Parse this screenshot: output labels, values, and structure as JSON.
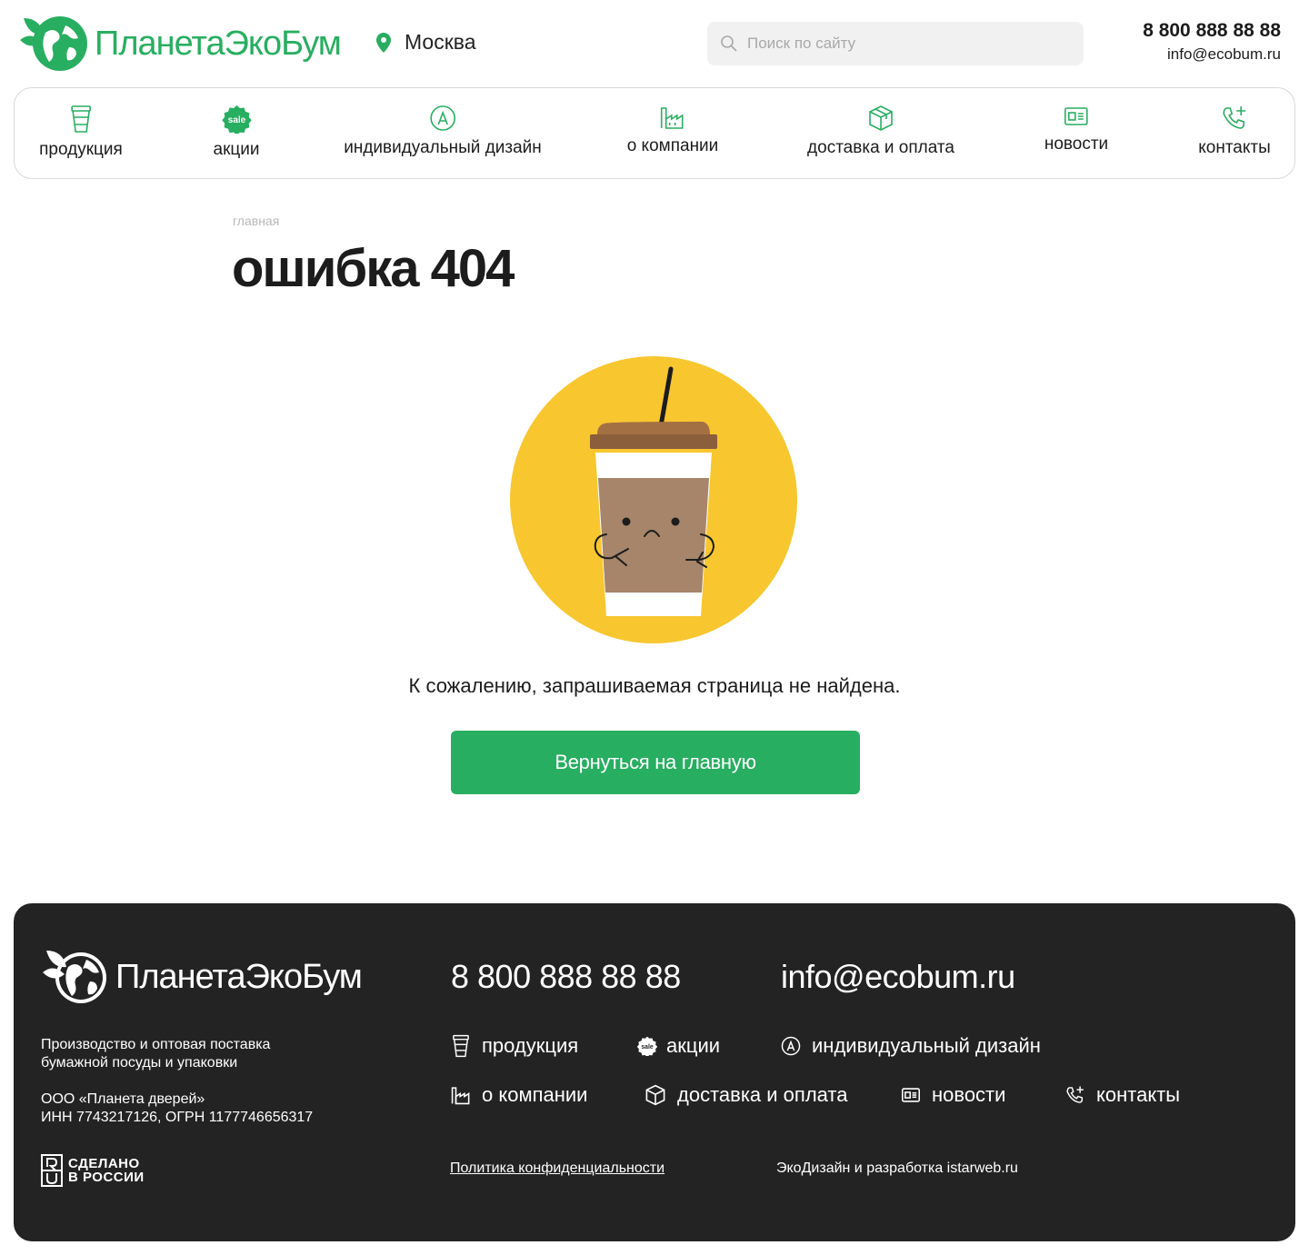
{
  "header": {
    "logo_text": "ПланетаЭкоБум",
    "city": "Москва",
    "search_placeholder": "Поиск по сайту",
    "phone": "8 800 888 88 88",
    "email": "info@ecobum.ru"
  },
  "nav": [
    {
      "label": "продукция",
      "icon": "cup-icon"
    },
    {
      "label": "акции",
      "icon": "sale-badge-icon"
    },
    {
      "label": "индивидуальный дизайн",
      "icon": "design-pen-icon"
    },
    {
      "label": "о компании",
      "icon": "factory-icon"
    },
    {
      "label": "доставка и оплата",
      "icon": "box-icon"
    },
    {
      "label": "новости",
      "icon": "newspaper-icon"
    },
    {
      "label": "контакты",
      "icon": "phone-plus-icon"
    }
  ],
  "sale_badge_text": "sale",
  "breadcrumb": "главная",
  "page_title": "ошибка 404",
  "message": "К сожалению, запрашиваемая страница не найдена.",
  "back_button": "Вернуться на главную",
  "footer": {
    "logo_text": "ПланетаЭкоБум",
    "description": "Производство и оптовая поставка бумажной посуды и упаковки",
    "org_line1": "ООО  «Планета дверей»",
    "org_line2": "ИНН 7743217126, ОГРН 1177746656317",
    "made_line1": "СДЕЛАНО",
    "made_line2": "В РОССИИ",
    "phone": "8 800 888 88 88",
    "email": "info@ecobum.ru",
    "links": [
      "продукция",
      "акции",
      "индивидуальный дизайн",
      "о компании",
      "доставка и оплата",
      "новости",
      "контакты"
    ],
    "policy": "Политика конфиденциальности",
    "developer": "ЭкоДизайн и разработка istarweb.ru"
  },
  "colors": {
    "brand_green": "#28ae60",
    "footer_bg": "#232323",
    "illustration_yellow": "#f8c62f",
    "cup_brown": "#a6856a",
    "lid_brown": "#8b5e3c"
  }
}
